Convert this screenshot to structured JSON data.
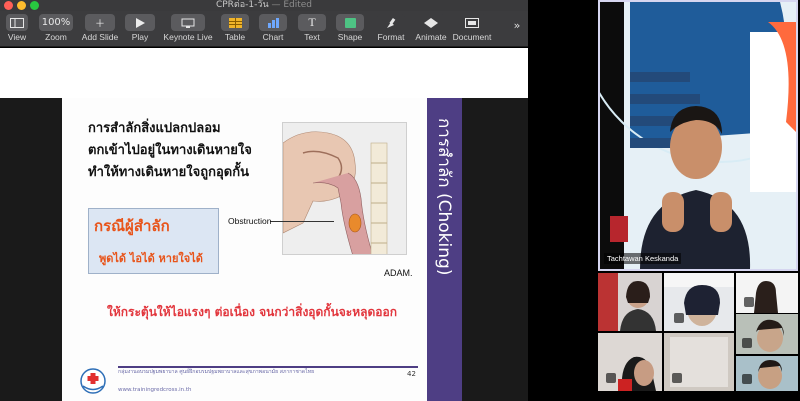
{
  "window": {
    "title": "CPRต่อ-1-วัน",
    "status": "— Edited"
  },
  "toolbar": {
    "view": "View",
    "zoom_value": "100%",
    "zoom": "Zoom",
    "add_slide": "Add Slide",
    "play": "Play",
    "keynote_live": "Keynote Live",
    "table": "Table",
    "chart": "Chart",
    "text": "Text",
    "shape": "Shape",
    "format": "Format",
    "animate": "Animate",
    "document": "Document",
    "overflow": "»"
  },
  "slide": {
    "intro_lines": [
      "การสำลักสิ่งแปลกปลอม",
      "ตกเข้าไปอยู่ในทางเดินหายใจ",
      "ทำให้ทางเดินหายใจถูกอุดกั้น"
    ],
    "case_title": "กรณีผู้สำลัก",
    "case_sub": "พูดได้ ไอได้ หายใจได้",
    "obstruction_label": "Obstruction",
    "adam": "ADAM.",
    "advice": "ให้กระตุ้นให้ไอแรงๆ ต่อเนื่อง จนกว่าสิ่งอุดกั้นจะหลุดออก",
    "side_title": "การสำลัก (Choking)",
    "footer_org": "กลุ่มงานอบรมปฐมพยาบาล ศูนย์ฝึกอบรมปฐมพยาบาลและสุขภาพอนามัย สภากาชาดไทย",
    "footer_url": "www.trainingredcross.in.th",
    "page_number": "42"
  },
  "video": {
    "speaker_name": "Tachtawan Keskanda"
  },
  "colors": {
    "accent_purple": "#4e3e84",
    "case_orange": "#e8541a",
    "advice_red": "#e2363d"
  }
}
